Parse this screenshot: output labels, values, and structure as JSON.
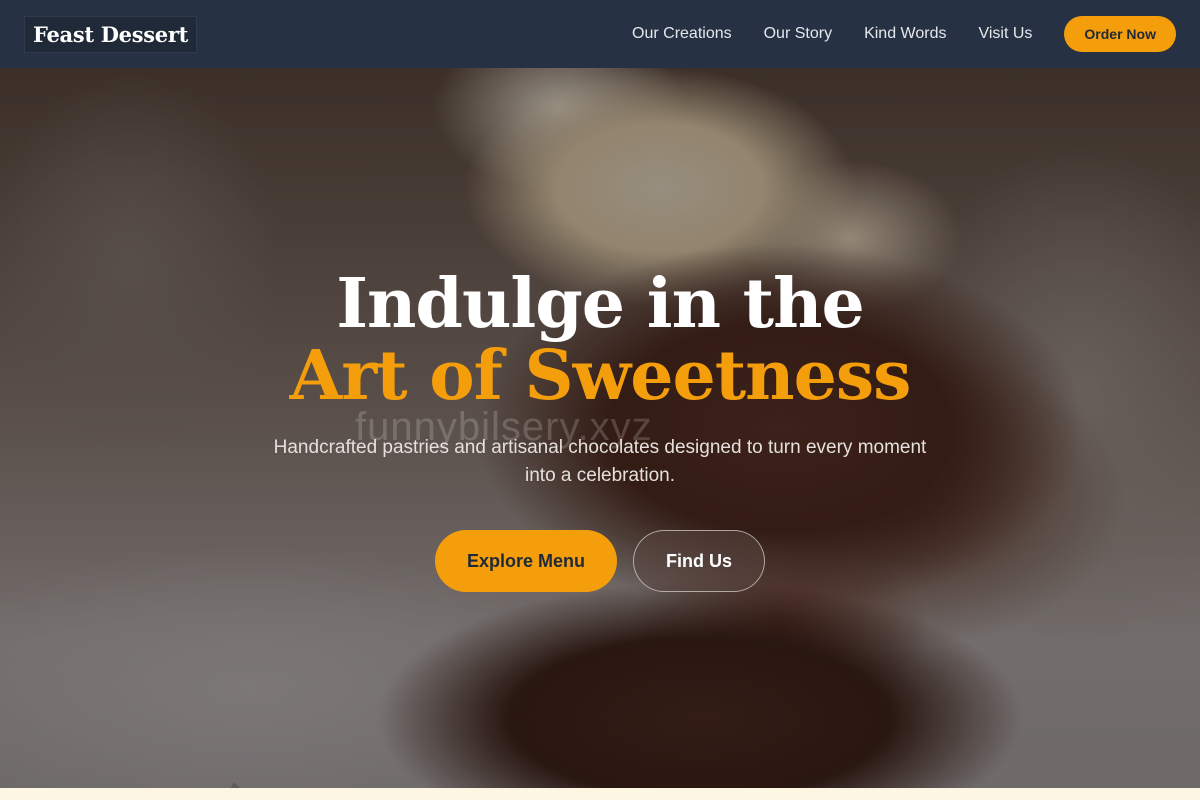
{
  "nav": {
    "logo": "Feast Dessert",
    "links": [
      "Our Creations",
      "Our Story",
      "Kind Words",
      "Visit Us"
    ],
    "order_label": "Order Now"
  },
  "hero": {
    "title_line1": "Indulge in the",
    "title_line2": "Art of Sweetness",
    "subtitle": "Handcrafted pastries and artisanal chocolates designed to turn every moment into a celebration.",
    "watermark": "funnybilsery.xyz",
    "primary_cta": "Explore Menu",
    "secondary_cta": "Find Us"
  },
  "colors": {
    "nav_bg": "#263244",
    "accent": "#f59e0b",
    "title_white": "#ffffff"
  },
  "icons": {
    "background": "brownie-with-ice-cream-photo"
  }
}
